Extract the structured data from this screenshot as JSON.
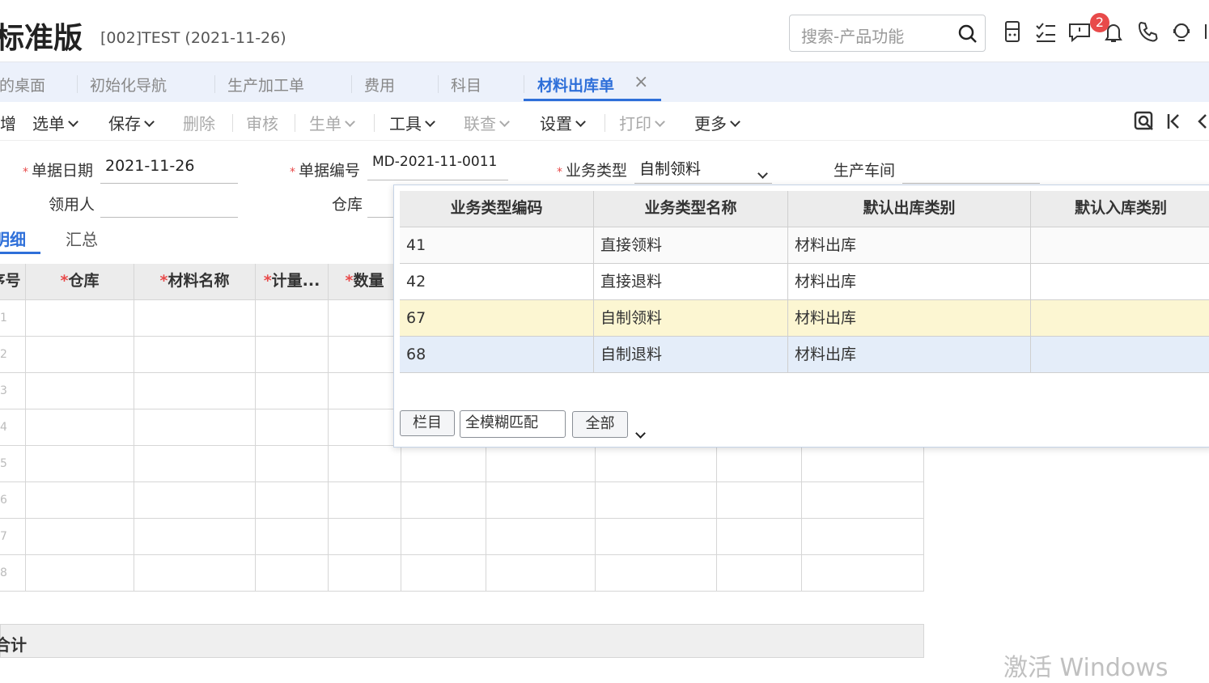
{
  "header": {
    "app_title": "标准版",
    "account": "[002]TEST   (2021-11-26)",
    "search_placeholder": "搜索-产品功能",
    "notification_count": "2"
  },
  "tabs": [
    {
      "label": "我的桌面"
    },
    {
      "label": "初始化导航"
    },
    {
      "label": "生产加工单"
    },
    {
      "label": "费用"
    },
    {
      "label": "科目"
    },
    {
      "label": "材料出库单"
    }
  ],
  "toolbar": {
    "new": "新增",
    "select": "选单",
    "save": "保存",
    "delete": "删除",
    "audit": "审核",
    "generate": "生单",
    "tools": "工具",
    "linked": "联查",
    "settings": "设置",
    "print": "打印",
    "more": "更多"
  },
  "form": {
    "doc_date_label": "单据日期",
    "doc_date": "2021-11-26",
    "doc_no_label": "单据编号",
    "doc_no": "MD-2021-11-0011",
    "biz_type_label": "业务类型",
    "biz_type": "自制领料",
    "workshop_label": "生产车间",
    "workshop": "",
    "recipient_label": "领用人",
    "recipient": "",
    "warehouse_label": "仓库",
    "warehouse": ""
  },
  "detail_tabs": {
    "detail": "明细",
    "summary": "汇总"
  },
  "grid": {
    "columns": [
      "序号",
      "仓库",
      "材料名称",
      "计量...",
      "数量"
    ],
    "rows": [
      "1",
      "2",
      "3",
      "4",
      "5",
      "6",
      "7",
      "8"
    ]
  },
  "total_label": "合计",
  "popup": {
    "columns": [
      "业务类型编码",
      "业务类型名称",
      "默认出库类别",
      "默认入库类别"
    ],
    "rows": [
      {
        "code": "41",
        "name": "直接领料",
        "out": "材料出库",
        "in": ""
      },
      {
        "code": "42",
        "name": "直接退料",
        "out": "材料出库",
        "in": ""
      },
      {
        "code": "67",
        "name": "自制领料",
        "out": "材料出库",
        "in": ""
      },
      {
        "code": "68",
        "name": "自制退料",
        "out": "材料出库",
        "in": ""
      }
    ],
    "btn_columns": "栏目",
    "match_mode": "全模糊匹配",
    "btn_all": "全部"
  },
  "colors": {
    "accent": "#2e6fd9",
    "selected_row": "#fcf6d2",
    "hover_row": "#e4edf9",
    "required": "#e84a4a"
  },
  "watermark": "激活 Windows"
}
